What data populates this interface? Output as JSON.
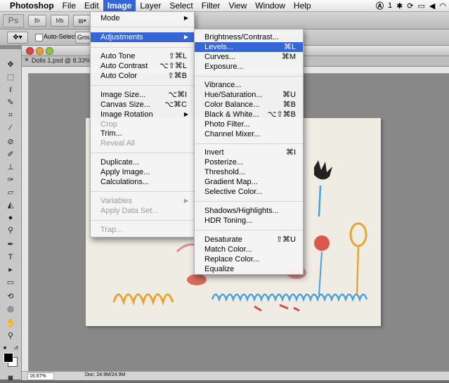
{
  "menubar": {
    "app": "Photoshop",
    "items": [
      "File",
      "Edit",
      "Image",
      "Layer",
      "Select",
      "Filter",
      "View",
      "Window",
      "Help"
    ],
    "active": "Image",
    "status_text": "1"
  },
  "appbar": {
    "logo": "Ps",
    "buttons": [
      "Br",
      "Mb"
    ]
  },
  "optionsbar": {
    "auto_select_label": "Auto-Select:",
    "auto_select_value": "Group"
  },
  "document": {
    "tab_title": "Dolls 1.psd @ 8.33% (",
    "close_glyph": "×"
  },
  "statusbar": {
    "zoom": "16.67%",
    "doc_size": "Doc: 24.9M/24.9M"
  },
  "image_menu": [
    {
      "label": "Mode",
      "submenu": true
    },
    {
      "sep": true
    },
    {
      "label": "Adjustments",
      "submenu": true,
      "highlight": true
    },
    {
      "sep": true
    },
    {
      "label": "Auto Tone",
      "shortcut": "⇧⌘L"
    },
    {
      "label": "Auto Contrast",
      "shortcut": "⌥⇧⌘L"
    },
    {
      "label": "Auto Color",
      "shortcut": "⇧⌘B"
    },
    {
      "sep": true
    },
    {
      "label": "Image Size...",
      "shortcut": "⌥⌘I"
    },
    {
      "label": "Canvas Size...",
      "shortcut": "⌥⌘C"
    },
    {
      "label": "Image Rotation",
      "submenu": true
    },
    {
      "label": "Crop",
      "disabled": true
    },
    {
      "label": "Trim..."
    },
    {
      "label": "Reveal All",
      "disabled": true
    },
    {
      "sep": true
    },
    {
      "label": "Duplicate..."
    },
    {
      "label": "Apply Image..."
    },
    {
      "label": "Calculations..."
    },
    {
      "sep": true
    },
    {
      "label": "Variables",
      "submenu": true,
      "disabled": true
    },
    {
      "label": "Apply Data Set...",
      "disabled": true
    },
    {
      "sep": true
    },
    {
      "label": "Trap...",
      "disabled": true
    }
  ],
  "adjustments_menu": [
    {
      "label": "Brightness/Contrast..."
    },
    {
      "label": "Levels...",
      "shortcut": "⌘L",
      "highlight": true
    },
    {
      "label": "Curves...",
      "shortcut": "⌘M"
    },
    {
      "label": "Exposure..."
    },
    {
      "sep": true
    },
    {
      "label": "Vibrance..."
    },
    {
      "label": "Hue/Saturation...",
      "shortcut": "⌘U"
    },
    {
      "label": "Color Balance...",
      "shortcut": "⌘B"
    },
    {
      "label": "Black & White...",
      "shortcut": "⌥⇧⌘B"
    },
    {
      "label": "Photo Filter..."
    },
    {
      "label": "Channel Mixer..."
    },
    {
      "sep": true
    },
    {
      "label": "Invert",
      "shortcut": "⌘I"
    },
    {
      "label": "Posterize..."
    },
    {
      "label": "Threshold..."
    },
    {
      "label": "Gradient Map..."
    },
    {
      "label": "Selective Color..."
    },
    {
      "sep": true
    },
    {
      "label": "Shadows/Highlights..."
    },
    {
      "label": "HDR Toning..."
    },
    {
      "sep": true
    },
    {
      "label": "Desaturate",
      "shortcut": "⇧⌘U"
    },
    {
      "label": "Match Color..."
    },
    {
      "label": "Replace Color..."
    },
    {
      "label": "Equalize"
    }
  ],
  "colors": {
    "highlight": "#3566d8",
    "disabled_text": "#9a9a9a"
  }
}
